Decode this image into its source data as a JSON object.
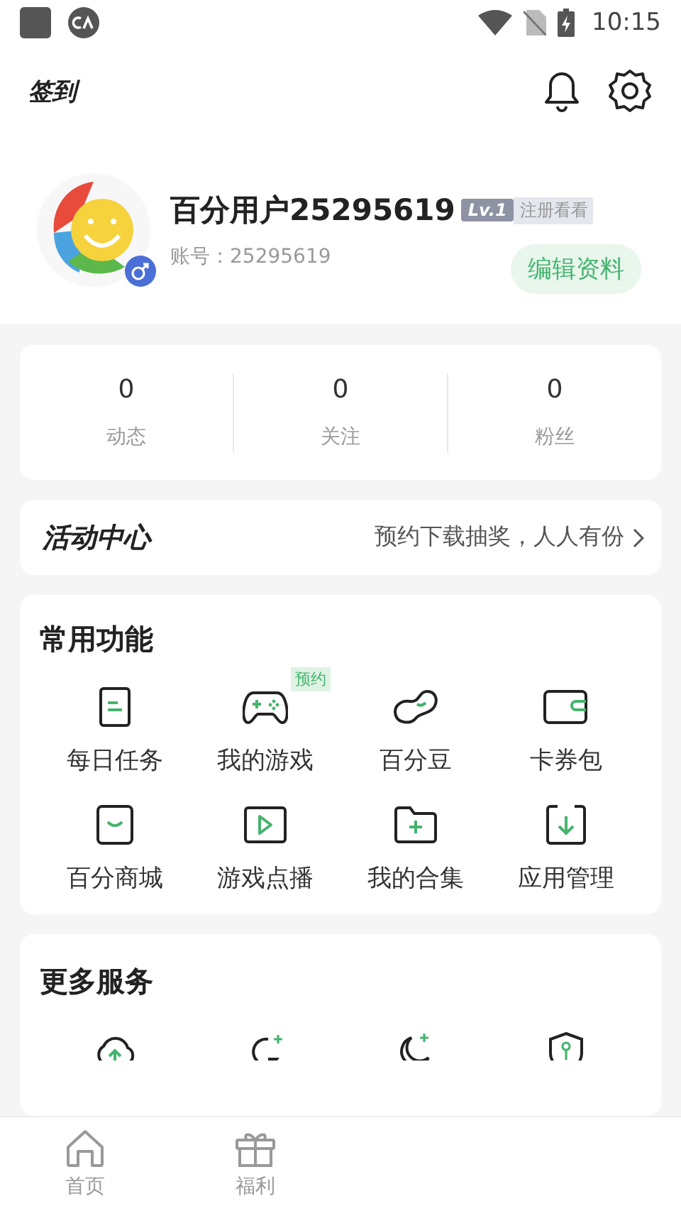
{
  "status_bar": {
    "time": "10:15"
  },
  "header": {
    "checkin": "签到"
  },
  "profile": {
    "name": "百分用户25295619",
    "level": "Lv.1",
    "level_note": "注册看看",
    "account": "账号：25295619",
    "edit_button": "编辑资料",
    "male": true
  },
  "stats": [
    {
      "value": "0",
      "label": "动态"
    },
    {
      "value": "0",
      "label": "关注"
    },
    {
      "value": "0",
      "label": "粉丝"
    }
  ],
  "activity": {
    "title": "活动中心",
    "promo": "预约下载抽奖，人人有份"
  },
  "common": {
    "title": "常用功能",
    "items": [
      {
        "label": "每日任务",
        "kind": "task"
      },
      {
        "label": "我的游戏",
        "kind": "gamepad",
        "badge": "预约"
      },
      {
        "label": "百分豆",
        "kind": "bean"
      },
      {
        "label": "卡券包",
        "kind": "wallet"
      },
      {
        "label": "百分商城",
        "kind": "shop"
      },
      {
        "label": "游戏点播",
        "kind": "play"
      },
      {
        "label": "我的合集",
        "kind": "folder"
      },
      {
        "label": "应用管理",
        "kind": "download"
      }
    ]
  },
  "more": {
    "title": "更多服务",
    "items": [
      {
        "kind": "cloud"
      },
      {
        "kind": "refresh"
      },
      {
        "kind": "moon"
      },
      {
        "kind": "shield"
      }
    ]
  },
  "nav": [
    {
      "label": "首页",
      "kind": "home",
      "selected": false
    },
    {
      "label": "福利",
      "kind": "gift",
      "selected": false
    }
  ]
}
